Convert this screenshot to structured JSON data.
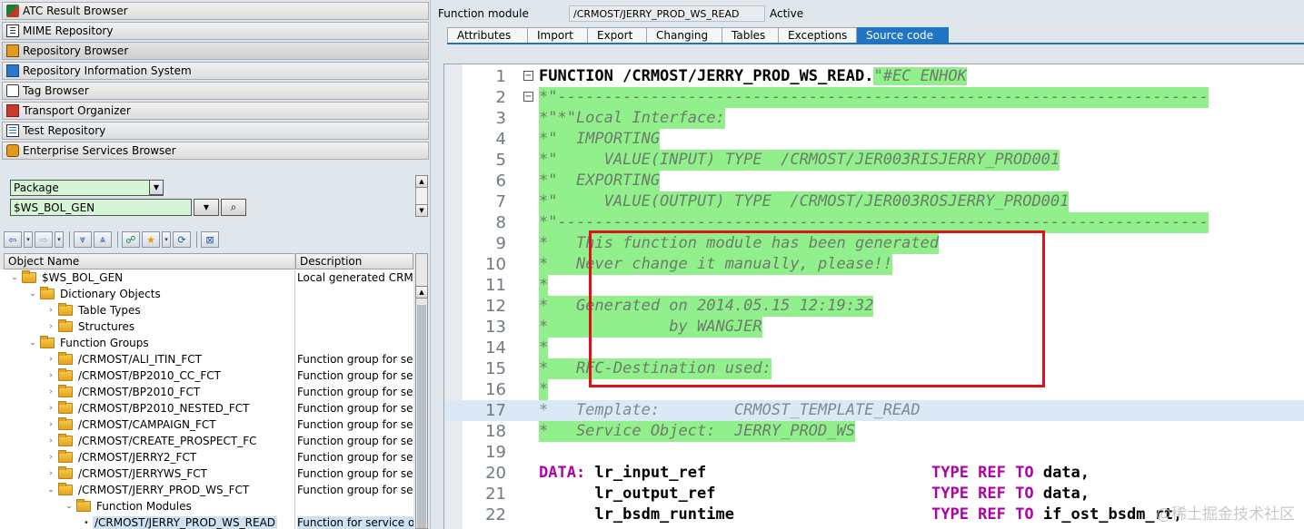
{
  "nav": {
    "items": [
      {
        "label": "ATC Result Browser",
        "icon": "atc-icon"
      },
      {
        "label": "MIME Repository",
        "icon": "mime-icon"
      },
      {
        "label": "Repository Browser",
        "icon": "repository-icon"
      },
      {
        "label": "Repository Information System",
        "icon": "info-system-icon"
      },
      {
        "label": "Tag Browser",
        "icon": "tag-icon"
      },
      {
        "label": "Transport Organizer",
        "icon": "transport-icon"
      },
      {
        "label": "Test Repository",
        "icon": "test-icon"
      },
      {
        "label": "Enterprise Services Browser",
        "icon": "esb-icon"
      }
    ]
  },
  "object_type": {
    "selected": "Package"
  },
  "object_name": {
    "value": "$WS_BOL_GEN"
  },
  "tree": {
    "col_name": "Object Name",
    "col_desc": "Description",
    "rows": [
      {
        "name": "$WS_BOL_GEN",
        "desc": "Local generated CRM ol"
      },
      {
        "name": "Dictionary Objects",
        "desc": ""
      },
      {
        "name": "Table Types",
        "desc": ""
      },
      {
        "name": "Structures",
        "desc": ""
      },
      {
        "name": "Function Groups",
        "desc": ""
      },
      {
        "name": "/CRMOST/ALI_ITIN_FCT",
        "desc": "Function group for serv"
      },
      {
        "name": "/CRMOST/BP2010_CC_FCT",
        "desc": "Function group for serv"
      },
      {
        "name": "/CRMOST/BP2010_FCT",
        "desc": "Function group for serv"
      },
      {
        "name": "/CRMOST/BP2010_NESTED_FCT",
        "desc": "Function group for serv"
      },
      {
        "name": "/CRMOST/CAMPAIGN_FCT",
        "desc": "Function group for serv"
      },
      {
        "name": "/CRMOST/CREATE_PROSPECT_FC",
        "desc": "Function group for serv"
      },
      {
        "name": "/CRMOST/JERRY2_FCT",
        "desc": "Function group for serv"
      },
      {
        "name": "/CRMOST/JERRYWS_FCT",
        "desc": "Function group for serv"
      },
      {
        "name": "/CRMOST/JERRY_PROD_WS_FCT",
        "desc": "Function group for serv"
      },
      {
        "name": "Function Modules",
        "desc": ""
      },
      {
        "name": "/CRMOST/JERRY_PROD_WS_READ",
        "desc": "Function for service obj"
      }
    ]
  },
  "header": {
    "fm_label": "Function module",
    "fm_value": "/CRMOST/JERRY_PROD_WS_READ",
    "status": "Active"
  },
  "tabs": [
    "Attributes",
    "Import",
    "Export",
    "Changing",
    "Tables",
    "Exceptions",
    "Source code"
  ],
  "active_tab": "Source code",
  "code": {
    "lines": [
      {
        "n": "1"
      },
      {
        "n": "2"
      },
      {
        "n": "3"
      },
      {
        "n": "4"
      },
      {
        "n": "5"
      },
      {
        "n": "6"
      },
      {
        "n": "7"
      },
      {
        "n": "8"
      },
      {
        "n": "9"
      },
      {
        "n": "10"
      },
      {
        "n": "11"
      },
      {
        "n": "12"
      },
      {
        "n": "13"
      },
      {
        "n": "14"
      },
      {
        "n": "15"
      },
      {
        "n": "16"
      },
      {
        "n": "17"
      },
      {
        "n": "18"
      },
      {
        "n": "19"
      },
      {
        "n": "20"
      },
      {
        "n": "21"
      },
      {
        "n": "22"
      }
    ],
    "l1_kw": "FUNCTION /CRMOST/JERRY_PROD_WS_READ.",
    "l1_cmt": "\"#EC ENHOK",
    "l2": "*\"----------------------------------------------------------------------",
    "l3": "*\"*\"Local Interface:",
    "l4": "*\"  IMPORTING",
    "l5": "*\"     VALUE(INPUT) TYPE  /CRMOST/JER003RISJERRY_PROD001",
    "l6": "*\"  EXPORTING",
    "l7": "*\"     VALUE(OUTPUT) TYPE  /CRMOST/JER003ROSJERRY_PROD001",
    "l8": "*\"----------------------------------------------------------------------",
    "l9": "*   This function module has been generated",
    "l10": "*   Never change it manually, please!!",
    "l11": "*",
    "l12": "*   Generated on 2014.05.15 12:19:32",
    "l13": "*             by WANGJER",
    "l14": "*",
    "l15": "*   RFC-Destination used:",
    "l16": "*",
    "l17": "*   Template:        CRMOST_TEMPLATE_READ",
    "l18": "*   Service Object:  JERRY_PROD_WS",
    "l20_kw": "DATA:",
    "l20_var": " lr_input_ref",
    "l21_var": "      lr_output_ref",
    "l22_var": "      lr_bsdm_runtime",
    "l20_type": "TYPE REF TO",
    "l20_tgt": " data,",
    "l21_tgt": " data,",
    "l22_tgt": " if_ost_bsdm_rt,"
  },
  "watermark": "@稀土掘金技术社区"
}
